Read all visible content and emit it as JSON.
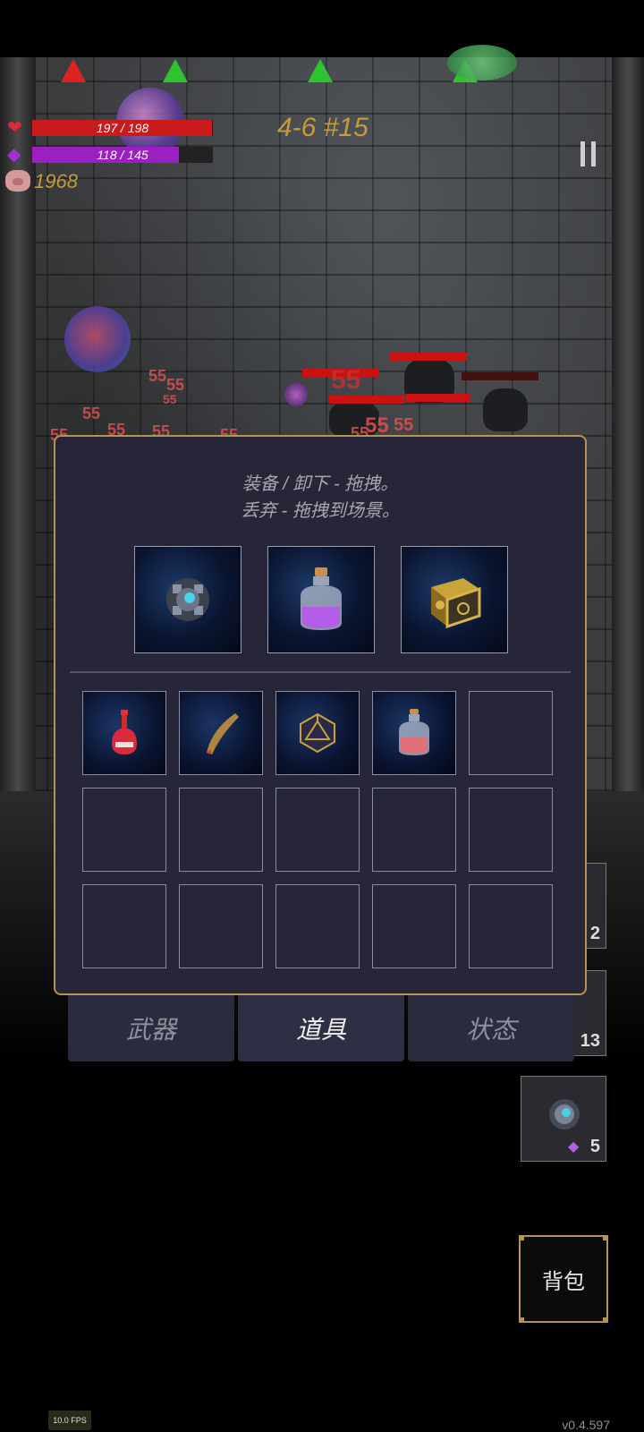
{
  "hud": {
    "hp_text": "197 / 198",
    "hp_fraction": 0.995,
    "mp_text": "118 / 145",
    "mp_fraction": 0.814,
    "coins": "1968",
    "level": "4-6 #15",
    "colors": {
      "hp": "#c91b1b",
      "mp": "#9c1fc2",
      "gold": "#c49a3a"
    }
  },
  "scene": {
    "damage_numbers": [
      "55",
      "55",
      "55",
      "55",
      "55",
      "55",
      "55",
      "55",
      "55",
      "55",
      "55",
      "55"
    ]
  },
  "panel": {
    "hint_line1": "装备 / 卸下 - 拖拽。",
    "hint_line2": "丢弃 - 拖拽到场景。",
    "equipped": [
      {
        "icon": "mechanical-orb-icon"
      },
      {
        "icon": "purple-potion-icon"
      },
      {
        "icon": "golden-cube-icon"
      }
    ],
    "inventory": [
      {
        "icon": "red-potion-icon"
      },
      {
        "icon": "horn-icon"
      },
      {
        "icon": "d20-dice-icon"
      },
      {
        "icon": "pink-potion-icon"
      }
    ]
  },
  "tabs": [
    {
      "label": "武器",
      "active": false
    },
    {
      "label": "道具",
      "active": true
    },
    {
      "label": "状态",
      "active": false
    }
  ],
  "quick_slots": [
    {
      "count": "2"
    },
    {
      "count": "13"
    },
    {
      "count": "5",
      "icon": "mechanical-orb-icon"
    }
  ],
  "bag_button": "背包",
  "fps": "10.0 FPS",
  "version": "v0.4.597"
}
